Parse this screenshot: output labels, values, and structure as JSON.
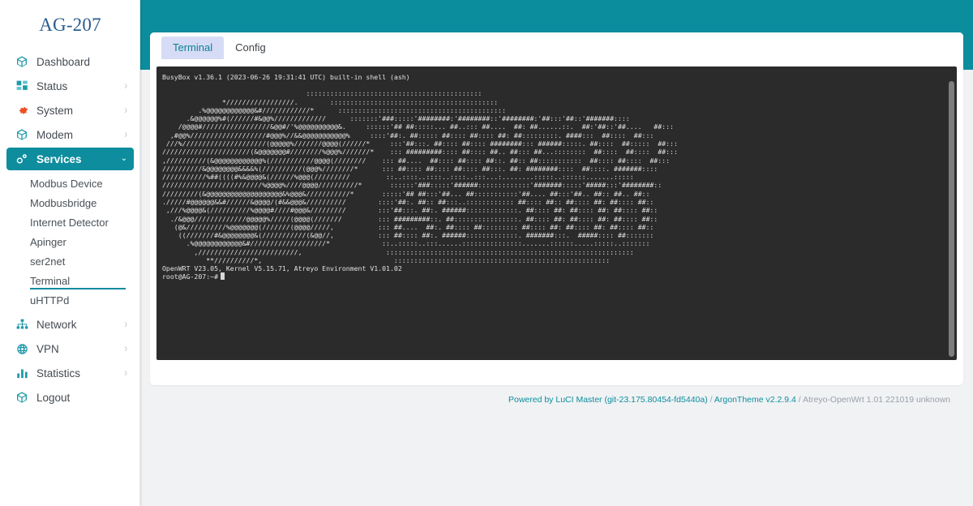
{
  "theme": {
    "accent": "#0d8d9e",
    "header_bg": "#0c8d9e",
    "content_bg": "#f0f2f4",
    "terminal_bg": "#2b2b2b",
    "terminal_fg": "#e2e2e2",
    "tab_active_bg": "#d6dcf5",
    "brand_color": "#2a5d8f",
    "gear_icon_color": "#f04e23"
  },
  "sidebar": {
    "brand": "AG-207",
    "items": [
      {
        "label": "Dashboard",
        "icon": "cube-icon",
        "expandable": false,
        "active": false
      },
      {
        "label": "Status",
        "icon": "grid-icon",
        "expandable": true,
        "active": false
      },
      {
        "label": "System",
        "icon": "gear-icon",
        "expandable": true,
        "active": false
      },
      {
        "label": "Modem",
        "icon": "cube-icon",
        "expandable": true,
        "active": false
      },
      {
        "label": "Services",
        "icon": "cogs-icon",
        "expandable": true,
        "active": true
      }
    ],
    "services_submenu": [
      {
        "label": "Modbus Device",
        "selected": false
      },
      {
        "label": "Modbusbridge",
        "selected": false
      },
      {
        "label": "Internet Detector",
        "selected": false
      },
      {
        "label": "Apinger",
        "selected": false
      },
      {
        "label": "ser2net",
        "selected": false
      },
      {
        "label": "Terminal",
        "selected": true
      },
      {
        "label": "uHTTPd",
        "selected": false
      }
    ],
    "items_after": [
      {
        "label": "Network",
        "icon": "sitemap-icon",
        "expandable": true,
        "active": false
      },
      {
        "label": "VPN",
        "icon": "globe-icon",
        "expandable": true,
        "active": false
      },
      {
        "label": "Statistics",
        "icon": "barchart-icon",
        "expandable": true,
        "active": false
      },
      {
        "label": "Logout",
        "icon": "cube-icon",
        "expandable": false,
        "active": false
      }
    ],
    "caret_collapsed": "›",
    "caret_expanded": "⌄"
  },
  "tabs": [
    {
      "label": "Terminal",
      "active": true
    },
    {
      "label": "Config",
      "active": false
    }
  ],
  "terminal": {
    "header": "BusyBox v1.36.1 (2023-06-26 19:31:41 UTC) built-in shell (ash)",
    "banner": "                                    ::::::::::::::::::::::::::::::::::::::::::::\n               */////////////////.        ::::::::::::::::::::::::::::::::::::::::::\n         .%@@@@@@@@@@@@&#////////////*      ::::::::::::::::::::::::::::::::::::::::::\n      .&@@@@@@%#(//////#&@@%/////////////      :::::::'###:::::'########:'########::'########:'##:::'##::'#######::::\n    /@@@@#/////////////////&@@#/'%@@@@@@@@@@&.     ::::::'## ##:::::... ##..::: ##....  ##: ##......::.  ##:'##::'##....   ##:::\n  ,#@@%///////////////////#@@@%//&&@@@@@@@@@@@%     ::::'##:. ##::::: ##:::: ##:::: ##: ##:::::::::. ####:::  ##::::  ##:::\n ///%/////////////////////(@@@@@%///////@@@@(//////*     :::'##:::. ##:::: ##:::: ########::: ######:::::. ##::::  ##:::::  ##:::\n//////////////////////(&@@@@@@@#////////%@@@%///////*    ::: #########:::: ##:::: ##.. ##::: ##...::::::::  ##::::  ##::::  ##:::\n,//////////(&@@@@@@@@@@@@%(///////////@@@@(////////    ::: ##....  ##:::: ##:::: ##::. ##:: ##:::::::::::  ##:::: ##::::  ##:::\n//////////&@@@@@@@@&&&&%(//////////(@@@%////////*      ::: ##:::: ##:::: ##:::: ##:::. ##: ########::::  ##::::. #######::::\n///////////%##((((#%&@@@@&(//////%@@@(/////////         ::..::::..::::..::::..:::...:........:::::..::::::.......:::::\n/////////////////////////%@@@@%////@@@@//////////*       ::::::'###:::::'######:::::::::::::'#######:::::'#####:::'########::\n/////////(&@@@@@@@@@@@@@@@@@@@&%@@@&///////////*       :::::'## ##:::'##... ##:::::::::::'##.... ##:::'##.. ##:: ##.. ##::\n./////#@@@@@@&&#//////&@@@@/(#&&@@@&//////////        ::::'##:. ##:: ##:::..:::::::::::: ##:::: ##:: ##:::: ##: ##:::: ##::\n ,///%@@@@&(//////////%@@@@#////#@@@&/////////        :::'##:::. ##:. ######:::::::::::::. ##:::: ##: ##:::: ##: ##:::: ##::\n  ./&@@@/////////////@@@@@%/////(@@@@(///////         ::: #########::. ##::::::::::::::::. ##:::: ##: ##:::: ##: ##:::: ##::\n   (@&//////////%@@@@@@@(///////(@@@@/////,           ::: ##....  ##:. ##:::: ##::::::::: ##:::: ##: ##:::: ##: ##:::: ##::\n    ((///////#&@@@@@@@@&(///////////(&@@//,           ::: ##:::: ##:. ######:::::::::::::. #######:::.  #####:::: ##:::::::\n      .%@@@@@@@@@@@@&#///////////////////*             ::..:::::..:::......:::::::::::::::.......::::::.....:::::..:::::::\n        ,/////////////////////////,                     ::::::::::::::::::::::::::::::::::::::::::::::::::::::::::::::\n           **//////////*,                                 ::::::::::::::::::::::::::::::::::::::::::::::::::::::",
    "version_line": "OpenWRT V23.05, Kernel V5.15.71, Atreyo Environment V1.01.02",
    "prompt": "root@AG-207:~#"
  },
  "footer": {
    "powered_by": "Powered by LuCI Master (git-23.175.80454-fd5440a)",
    "separator_1": " / ",
    "theme": "ArgonTheme v2.2.9.4",
    "separator_2": " / ",
    "firmware": "Atreyo-OpenWrt 1.01 221019 unknown"
  }
}
